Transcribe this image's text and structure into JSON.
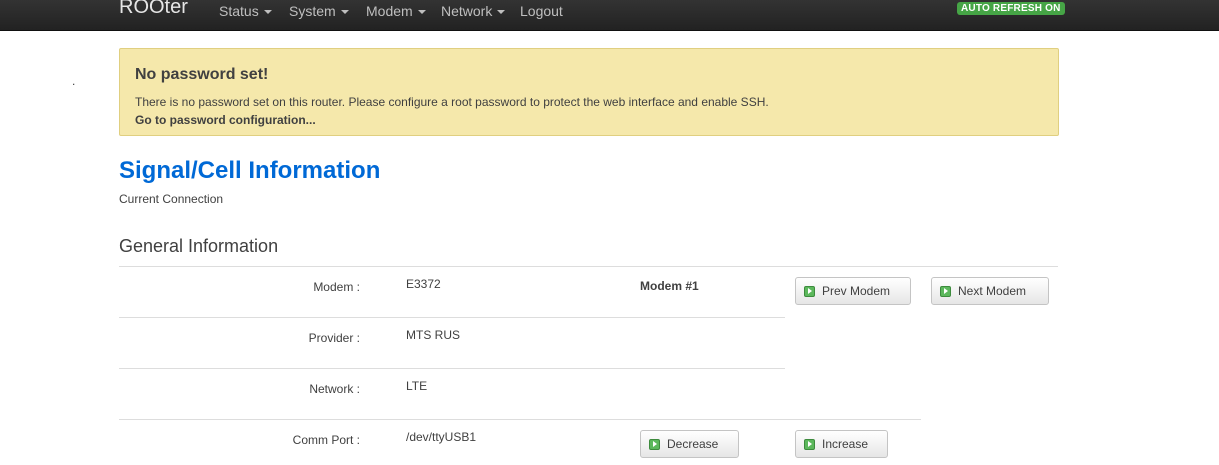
{
  "navbar": {
    "brand": "ROOter",
    "menu": [
      "Status",
      "System",
      "Modem",
      "Network",
      "Logout"
    ],
    "auto_refresh": "AUTO REFRESH ON"
  },
  "stray_dot": ".",
  "alert": {
    "title": "No password set!",
    "text": "There is no password set on this router. Please configure a root password to protect the web interface and enable SSH.",
    "link": "Go to password configuration..."
  },
  "page": {
    "title": "Signal/Cell Information",
    "subtitle": "Current Connection",
    "section": "General Information"
  },
  "info": {
    "modem_label": "Modem :",
    "modem_value": "E3372",
    "modem_number": "Modem #1",
    "provider_label": "Provider :",
    "provider_value": "MTS RUS",
    "network_label": "Network :",
    "network_value": "LTE",
    "comm_port_label": "Comm Port :",
    "comm_port_value": "/dev/ttyUSB1"
  },
  "buttons": {
    "prev_modem": "Prev Modem",
    "next_modem": "Next Modem",
    "decrease": "Decrease",
    "increase": "Increase"
  },
  "colors": {
    "navbar": "#222222",
    "alert_bg": "#f5e8ab",
    "title_blue": "#0069d6",
    "badge_green": "#46a546"
  }
}
